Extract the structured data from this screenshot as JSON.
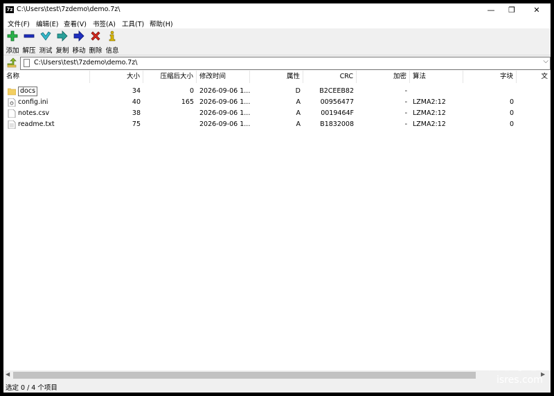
{
  "window": {
    "title": "C:\\Users\\test\\7zdemo\\demo.7z\\",
    "app_icon_text": "7z",
    "controls": {
      "minimize": "—",
      "maximize": "❐",
      "close": "✕"
    }
  },
  "menu": [
    "文件(F)",
    "编辑(E)",
    "查看(V)",
    "书签(A)",
    "工具(T)",
    "帮助(H)"
  ],
  "toolbar": [
    {
      "label": "添加",
      "icon": "plus-icon",
      "color": "#2bb34a"
    },
    {
      "label": "解压",
      "icon": "minus-icon",
      "color": "#1f2fbf"
    },
    {
      "label": "测试",
      "icon": "check-icon",
      "color": "#35b7c9"
    },
    {
      "label": "复制",
      "icon": "copy-arrow-icon",
      "color": "#2aa09a"
    },
    {
      "label": "移动",
      "icon": "move-arrow-icon",
      "color": "#1f2fbf"
    },
    {
      "label": "删除",
      "icon": "delete-x-icon",
      "color": "#d62a1f"
    },
    {
      "label": "信息",
      "icon": "info-icon",
      "color": "#d9b700"
    }
  ],
  "address": {
    "path": "C:\\Users\\test\\7zdemo\\demo.7z\\"
  },
  "columns": [
    "名称",
    "大小",
    "压缩后大小",
    "修改时间",
    "属性",
    "CRC",
    "加密",
    "算法",
    "字块",
    "文"
  ],
  "files": [
    {
      "name": "docs",
      "type": "folder",
      "size": "34",
      "packed": "0",
      "modified": "2026-09-06 1...",
      "attr": "D",
      "crc": "B2CEEB82",
      "enc": "-",
      "method": "",
      "block": ""
    },
    {
      "name": "config.ini",
      "type": "file",
      "size": "40",
      "packed": "165",
      "modified": "2026-09-06 1...",
      "attr": "A",
      "crc": "00956477",
      "enc": "-",
      "method": "LZMA2:12",
      "block": "0"
    },
    {
      "name": "notes.csv",
      "type": "file",
      "size": "38",
      "packed": "",
      "modified": "2026-09-06 1...",
      "attr": "A",
      "crc": "0019464F",
      "enc": "-",
      "method": "LZMA2:12",
      "block": "0"
    },
    {
      "name": "readme.txt",
      "type": "file",
      "size": "75",
      "packed": "",
      "modified": "2026-09-06 1...",
      "attr": "A",
      "crc": "B1832008",
      "enc": "-",
      "method": "LZMA2:12",
      "block": "0"
    }
  ],
  "status": "选定 0 / 4 个项目",
  "watermark": {
    "line1": "爱思考吧",
    "line2": "isres.com"
  }
}
